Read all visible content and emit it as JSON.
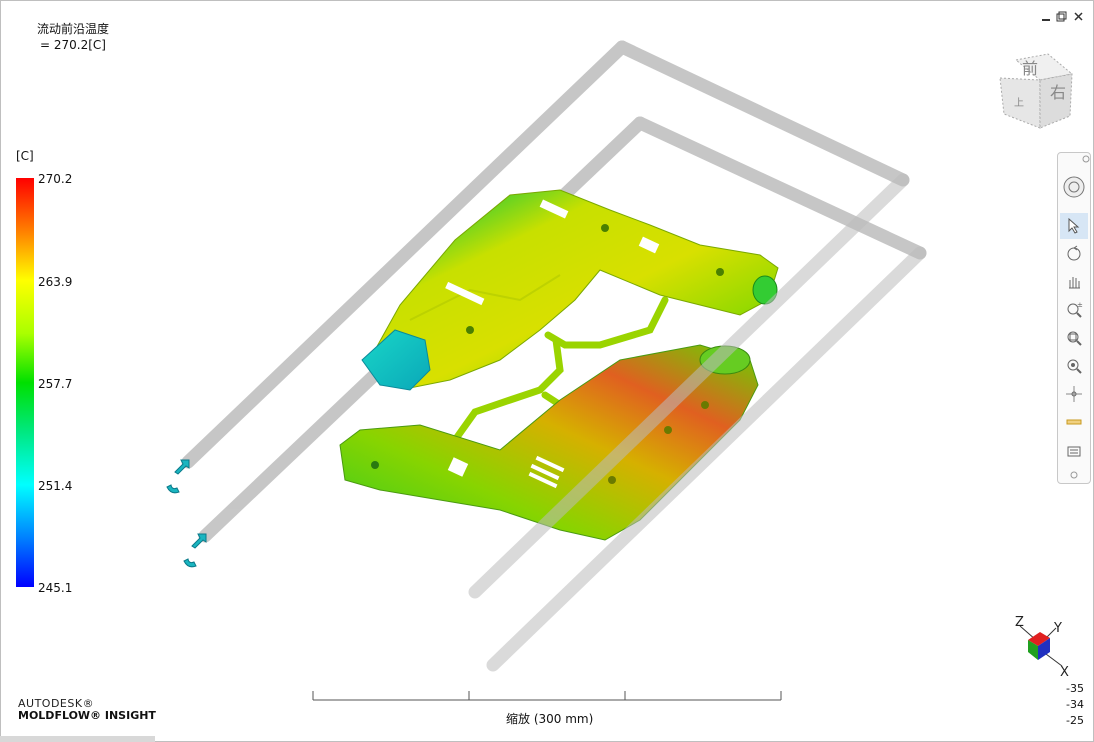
{
  "result": {
    "title": "流动前沿温度",
    "value": " = 270.2[C]"
  },
  "legend": {
    "unit": "[C]",
    "labels": [
      "270.2",
      "263.9",
      "257.7",
      "251.4",
      "245.1"
    ],
    "colors": {
      "max": "#ff0000",
      "mid": "#00e000",
      "min": "#0000ff"
    }
  },
  "window_controls": {
    "minimize_icon": "minimize-icon",
    "restore_icon": "restore-icon",
    "close_icon": "close-icon"
  },
  "viewcube": {
    "front_label": "前",
    "right_label": "右",
    "top_label": "上"
  },
  "toolbar": {
    "tools": [
      "steering-wheel-icon",
      "select-icon",
      "rotate-icon",
      "pan-icon",
      "zoom-icon",
      "zoom-window-icon",
      "fit-icon",
      "center-icon",
      "measure-icon",
      "view-icon"
    ]
  },
  "branding": {
    "company": "AUTODESK®",
    "product": "MOLDFLOW® INSIGHT"
  },
  "scale": {
    "label": "缩放 (300 mm)"
  },
  "triad": {
    "x": "X",
    "y": "Y",
    "z": "Z"
  },
  "coordinates": [
    "-35",
    "-34",
    "-25"
  ]
}
